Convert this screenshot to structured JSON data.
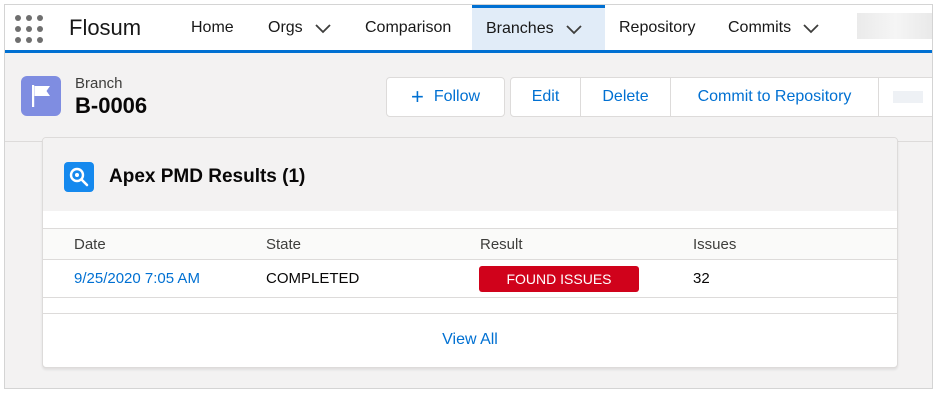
{
  "app": {
    "name": "Flosum",
    "nav": [
      {
        "label": "Home",
        "dropdown": false,
        "active": false
      },
      {
        "label": "Orgs",
        "dropdown": true,
        "active": false
      },
      {
        "label": "Comparison",
        "dropdown": false,
        "active": false
      },
      {
        "label": "Branches",
        "dropdown": true,
        "active": true
      },
      {
        "label": "Repository",
        "dropdown": false,
        "active": false
      },
      {
        "label": "Commits",
        "dropdown": true,
        "active": false
      }
    ],
    "accent_color": "#0070d2"
  },
  "record": {
    "type_label": "Branch",
    "name": "B-0006",
    "icon": "flag-icon",
    "actions": {
      "follow": "Follow",
      "edit": "Edit",
      "delete": "Delete",
      "commit": "Commit to Repository"
    }
  },
  "card": {
    "icon": "search-icon",
    "title": "Apex PMD Results (1)",
    "columns": [
      "Date",
      "State",
      "Result",
      "Issues"
    ],
    "rows": [
      {
        "date": "9/25/2020 7:05 AM",
        "state": "COMPLETED",
        "result": "FOUND ISSUES",
        "issues": "32"
      }
    ],
    "result_color": "#d0021b",
    "view_all": "View All"
  }
}
